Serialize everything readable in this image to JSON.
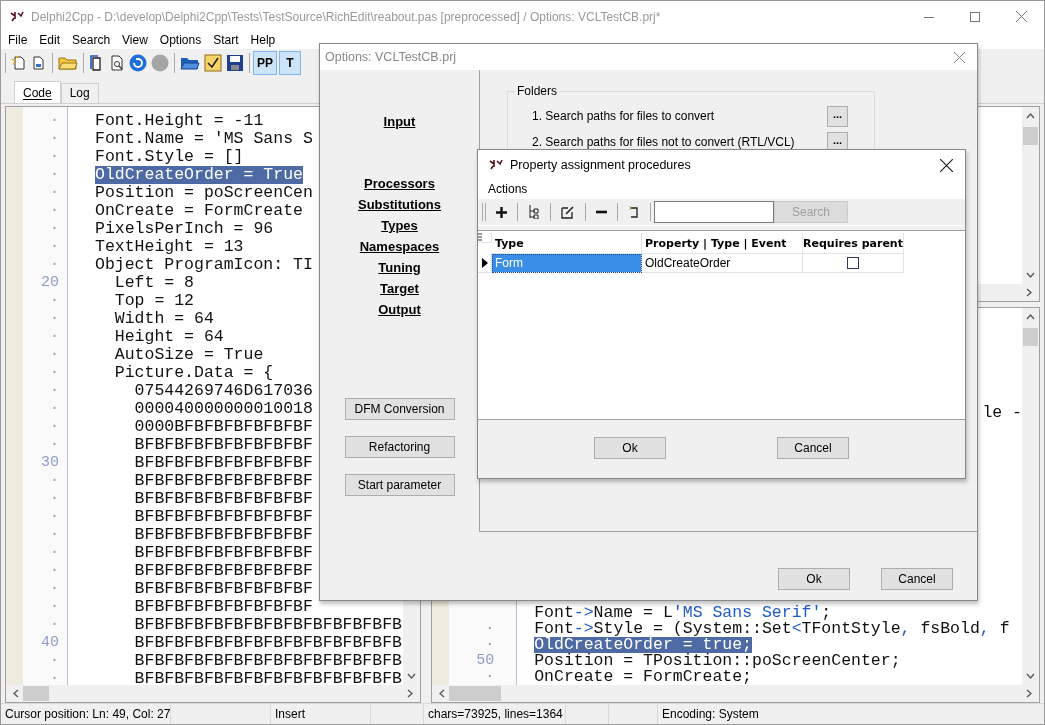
{
  "window": {
    "title": "Delphi2Cpp - D:\\develop\\Delphi2Cpp\\Tests\\TestSource\\RichEdit\\reabout.pas [preprocessed]  /  Options: VCLTestCB.prj*"
  },
  "menu": [
    "File",
    "Edit",
    "Search",
    "View",
    "Options",
    "Start",
    "Help"
  ],
  "toolbar_toggles": [
    {
      "label": "PP",
      "selected": true
    },
    {
      "label": "T",
      "selected": true
    }
  ],
  "tabs": [
    {
      "label": "Code",
      "selected": true
    },
    {
      "label": "Log",
      "selected": false
    }
  ],
  "left_editor": {
    "lines": [
      {
        "gutter": "·",
        "text": "Font.Height = -11",
        "selected": false
      },
      {
        "gutter": "·",
        "text": "Font.Name = 'MS Sans S",
        "selected": false
      },
      {
        "gutter": "·",
        "text": "Font.Style = []",
        "selected": false
      },
      {
        "gutter": "·",
        "text": "OldCreateOrder = True",
        "selected": true
      },
      {
        "gutter": "·",
        "text": "Position = poScreenCen",
        "selected": false
      },
      {
        "gutter": "·",
        "text": "OnCreate = FormCreate",
        "selected": false
      },
      {
        "gutter": "·",
        "text": "PixelsPerInch = 96",
        "selected": false
      },
      {
        "gutter": "·",
        "text": "TextHeight = 13",
        "selected": false
      },
      {
        "gutter": "·",
        "text": "Object ProgramIcon: TI",
        "selected": false
      },
      {
        "gutter": "20",
        "text": "  Left = 8",
        "selected": false
      },
      {
        "gutter": "·",
        "text": "  Top = 12",
        "selected": false
      },
      {
        "gutter": "·",
        "text": "  Width = 64",
        "selected": false
      },
      {
        "gutter": "·",
        "text": "  Height = 64",
        "selected": false
      },
      {
        "gutter": "·",
        "text": "  AutoSize = True",
        "selected": false
      },
      {
        "gutter": "·",
        "text": "  Picture.Data = {",
        "selected": false
      },
      {
        "gutter": "·",
        "text": "    07544269746D617036",
        "selected": false
      },
      {
        "gutter": "·",
        "text": "    000040000000010018",
        "selected": false
      },
      {
        "gutter": "·",
        "text": "    0000BFBFBFBFBFBFBF",
        "selected": false
      },
      {
        "gutter": "·",
        "text": "    BFBFBFBFBFBFBFBFBF",
        "selected": false
      },
      {
        "gutter": "30",
        "text": "    BFBFBFBFBFBFBFBFBF",
        "selected": false
      },
      {
        "gutter": "·",
        "text": "    BFBFBFBFBFBFBFBFBF",
        "selected": false
      },
      {
        "gutter": "·",
        "text": "    BFBFBFBFBFBFBFBFBF",
        "selected": false
      },
      {
        "gutter": "·",
        "text": "    BFBFBFBFBFBFBFBFBF",
        "selected": false
      },
      {
        "gutter": "·",
        "text": "    BFBFBFBFBFBFBFBFBF",
        "selected": false
      },
      {
        "gutter": "·",
        "text": "    BFBFBFBFBFBFBFBFBF",
        "selected": false
      },
      {
        "gutter": "·",
        "text": "    BFBFBFBFBFBFBFBFBF",
        "selected": false
      },
      {
        "gutter": "·",
        "text": "    BFBFBFBFBFBFBFBFBF",
        "selected": false
      },
      {
        "gutter": "·",
        "text": "    BFBFBFBFBFBFBFBFBF",
        "selected": false
      },
      {
        "gutter": "·",
        "text": "    BFBFBFBFBFBFBFBFBFBFBFBFBFB",
        "selected": false
      },
      {
        "gutter": "40",
        "text": "    BFBFBFBFBFBFBFBFBFBFBFBFBFB",
        "selected": false
      },
      {
        "gutter": "·",
        "text": "    BFBFBFBFBFBFBFBFBFBFBFBFBFB",
        "selected": false
      },
      {
        "gutter": "·",
        "text": "    BFBFBFBFBFBFBFBFBFBFBFBFBFB",
        "selected": false
      }
    ]
  },
  "right_editor": {
    "fragment": "le -",
    "lines": [
      {
        "selected": false,
        "segments": [
          {
            "kind": "plain",
            "text": "Font"
          },
          {
            "kind": "op",
            "text": "->"
          },
          {
            "kind": "plain",
            "text": "Name = L"
          },
          {
            "kind": "op",
            "text": "'MS Sans Serif'"
          },
          {
            "kind": "plain",
            "text": ";"
          }
        ]
      },
      {
        "gutter": "·",
        "selected": false,
        "segments": [
          {
            "kind": "plain",
            "text": "Font"
          },
          {
            "kind": "op",
            "text": "->"
          },
          {
            "kind": "plain",
            "text": "Style = (System::Set"
          },
          {
            "kind": "op",
            "text": "<"
          },
          {
            "kind": "plain",
            "text": "TFontStyle"
          },
          {
            "kind": "op",
            "text": ", "
          },
          {
            "kind": "plain",
            "text": "fsBold"
          },
          {
            "kind": "op",
            "text": ", "
          },
          {
            "kind": "plain",
            "text": "f"
          }
        ]
      },
      {
        "gutter": "·",
        "selected": true,
        "segments": [
          {
            "kind": "plain",
            "text": "OldCreateOrder = true;"
          }
        ]
      },
      {
        "gutter": "50",
        "selected": false,
        "segments": [
          {
            "kind": "plain",
            "text": "Position = TPosition::poScreenCenter;"
          }
        ]
      },
      {
        "gutter": "·",
        "selected": false,
        "segments": [
          {
            "kind": "plain",
            "text": "OnCreate = FormCreate;"
          }
        ]
      }
    ]
  },
  "options_dialog": {
    "title": "Options: VCLTestCB.prj",
    "nav_groups": [
      [
        "Input"
      ],
      [
        "Processors",
        "Substitutions",
        "Types",
        "Namespaces",
        "Tuning",
        "Target",
        "Output"
      ]
    ],
    "side_buttons": [
      "DFM Conversion",
      "Refactoring",
      "Start parameter"
    ],
    "folders": {
      "title": "Folders",
      "rows": [
        {
          "label": "1. Search paths for files to convert",
          "button": "..."
        },
        {
          "label": "2. Search paths for files not to convert (RTL/VCL)",
          "button": "..."
        }
      ]
    },
    "buttons": [
      "Ok",
      "Cancel"
    ]
  },
  "property_dialog": {
    "title": "Property assignment procedures",
    "menu": "Actions",
    "search_button": {
      "label": "Search",
      "disabled": true
    },
    "columns": [
      "Type",
      "Property | Type | Event",
      "Requires parent"
    ],
    "rows": [
      {
        "type": "Form",
        "property": "OldCreateOrder",
        "requires_parent": false,
        "selected": true
      }
    ],
    "buttons": [
      "Ok",
      "Cancel"
    ]
  },
  "status_bar": [
    "Cursor position: Ln: 49, Col: 27",
    "Insert",
    "chars=73925, lines=1364",
    "Encoding: System"
  ]
}
